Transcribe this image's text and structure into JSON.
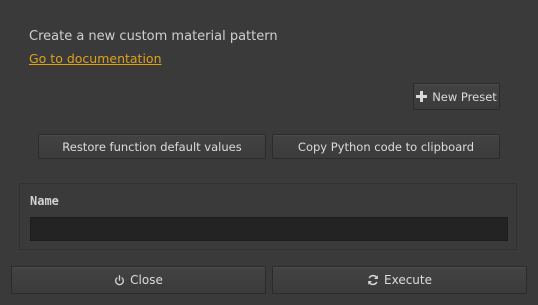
{
  "header": {
    "description": "Create a new custom material pattern",
    "doc_link": "Go to documentation"
  },
  "toolbar": {
    "new_preset_label": "New Preset",
    "restore_label": "Restore function default values",
    "copy_python_label": "Copy Python code to clipboard"
  },
  "params": {
    "name_label": "Name",
    "name_value": ""
  },
  "footer": {
    "close_label": "Close",
    "execute_label": "Execute"
  },
  "icons": {
    "new_preset": "plus-icon",
    "close": "power-icon",
    "execute": "refresh-icon"
  },
  "colors": {
    "background": "#3a3a3a",
    "link": "#e0a11b",
    "input": "#232323"
  }
}
